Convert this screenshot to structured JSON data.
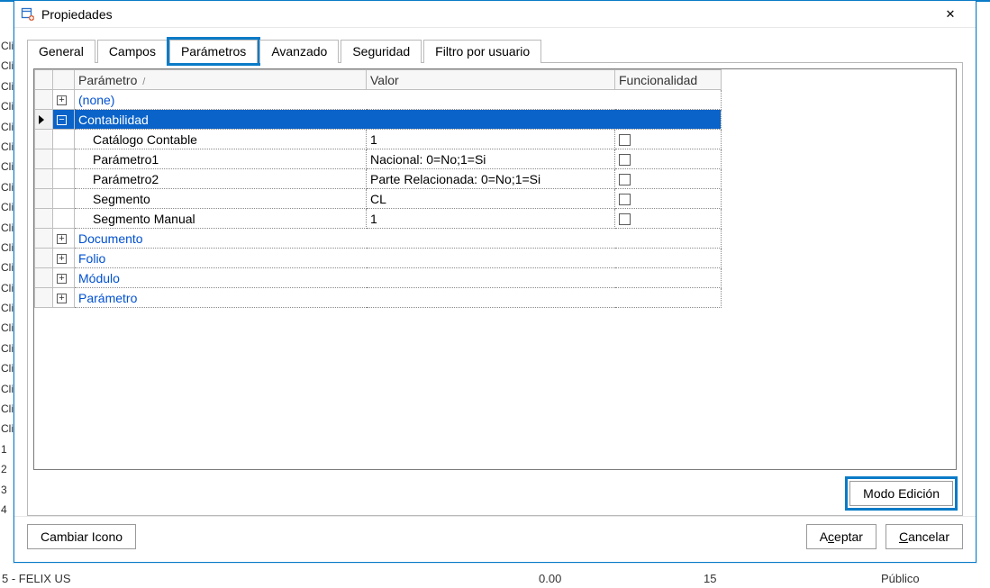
{
  "window": {
    "title": "Propiedades",
    "close_label": "✕"
  },
  "tabs": [
    "General",
    "Campos",
    "Parámetros",
    "Avanzado",
    "Seguridad",
    "Filtro por usuario"
  ],
  "active_tab_index": 2,
  "columns": {
    "parametro": "Parámetro",
    "sort_glyph": "/",
    "valor": "Valor",
    "funcionalidad": "Funcionalidad"
  },
  "groups": [
    {
      "expanded": false,
      "label": "(none)",
      "selected": false
    },
    {
      "expanded": true,
      "label": "Contabilidad",
      "selected": true,
      "rows": [
        {
          "param": "Catálogo Contable",
          "valor": "1",
          "func_checked": false
        },
        {
          "param": "Parámetro1",
          "valor": "Nacional: 0=No;1=Si",
          "func_checked": false
        },
        {
          "param": "Parámetro2",
          "valor": "Parte Relacionada: 0=No;1=Si",
          "func_checked": false
        },
        {
          "param": "Segmento",
          "valor": "CL",
          "func_checked": false
        },
        {
          "param": "Segmento Manual",
          "valor": "1",
          "func_checked": false
        }
      ]
    },
    {
      "expanded": false,
      "label": "Documento",
      "selected": false
    },
    {
      "expanded": false,
      "label": "Folio",
      "selected": false
    },
    {
      "expanded": false,
      "label": "Módulo",
      "selected": false
    },
    {
      "expanded": false,
      "label": "Parámetro",
      "selected": false
    }
  ],
  "buttons": {
    "edit_mode": "Modo Edición",
    "change_icon": "Cambiar Icono",
    "accept_pre": "A",
    "accept_k": "c",
    "accept_post": "eptar",
    "cancel_pre": "",
    "cancel_k": "C",
    "cancel_post": "ancelar"
  },
  "background": {
    "left_repeat": "Clie",
    "numbers_prefix": [
      "1",
      "2",
      "3",
      "4"
    ],
    "bottom_label": "5 - FELIX US",
    "num1": "0.00",
    "num2": "15",
    "num3": "Público"
  }
}
